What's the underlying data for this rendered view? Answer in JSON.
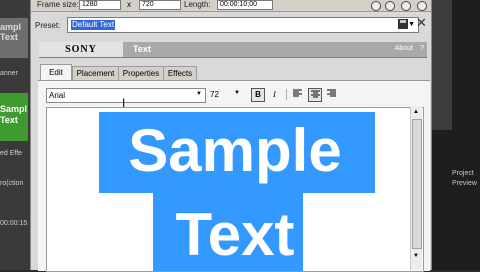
{
  "window": {
    "frame_size_label": "Frame size:",
    "frame_width": "1280",
    "x_sep": "x",
    "frame_height": "720",
    "length_label": "Length:",
    "length_value": "00:00:10;00"
  },
  "preset": {
    "label": "Preset:",
    "value": "Default Text"
  },
  "plugin": {
    "brand": "SONY",
    "name": "Text",
    "about": "About",
    "help": "?"
  },
  "tabs": [
    {
      "label": "Edit",
      "active": true
    },
    {
      "label": "Placement"
    },
    {
      "label": "Properties"
    },
    {
      "label": "Effects"
    }
  ],
  "toolbar": {
    "font": "Arial",
    "size": "72",
    "bold": "B",
    "italic": "I"
  },
  "editor": {
    "line1": "Sample",
    "line2": "Text"
  },
  "background": {
    "left_thumb_text": "ampl\nText",
    "left_label_1": "anner",
    "left_green_text": "Sampl\nText",
    "left_label_2": "ed Effe",
    "left_label_3": "ro(сtion",
    "left_label_4": "00:00:15",
    "right_label_1": "Project",
    "right_label_2": "Preview"
  },
  "colors": {
    "selection": "#3399ff",
    "dialog": "#d9d9d9",
    "header": "#a9a9a9",
    "green_clip": "#3f9a2f"
  }
}
